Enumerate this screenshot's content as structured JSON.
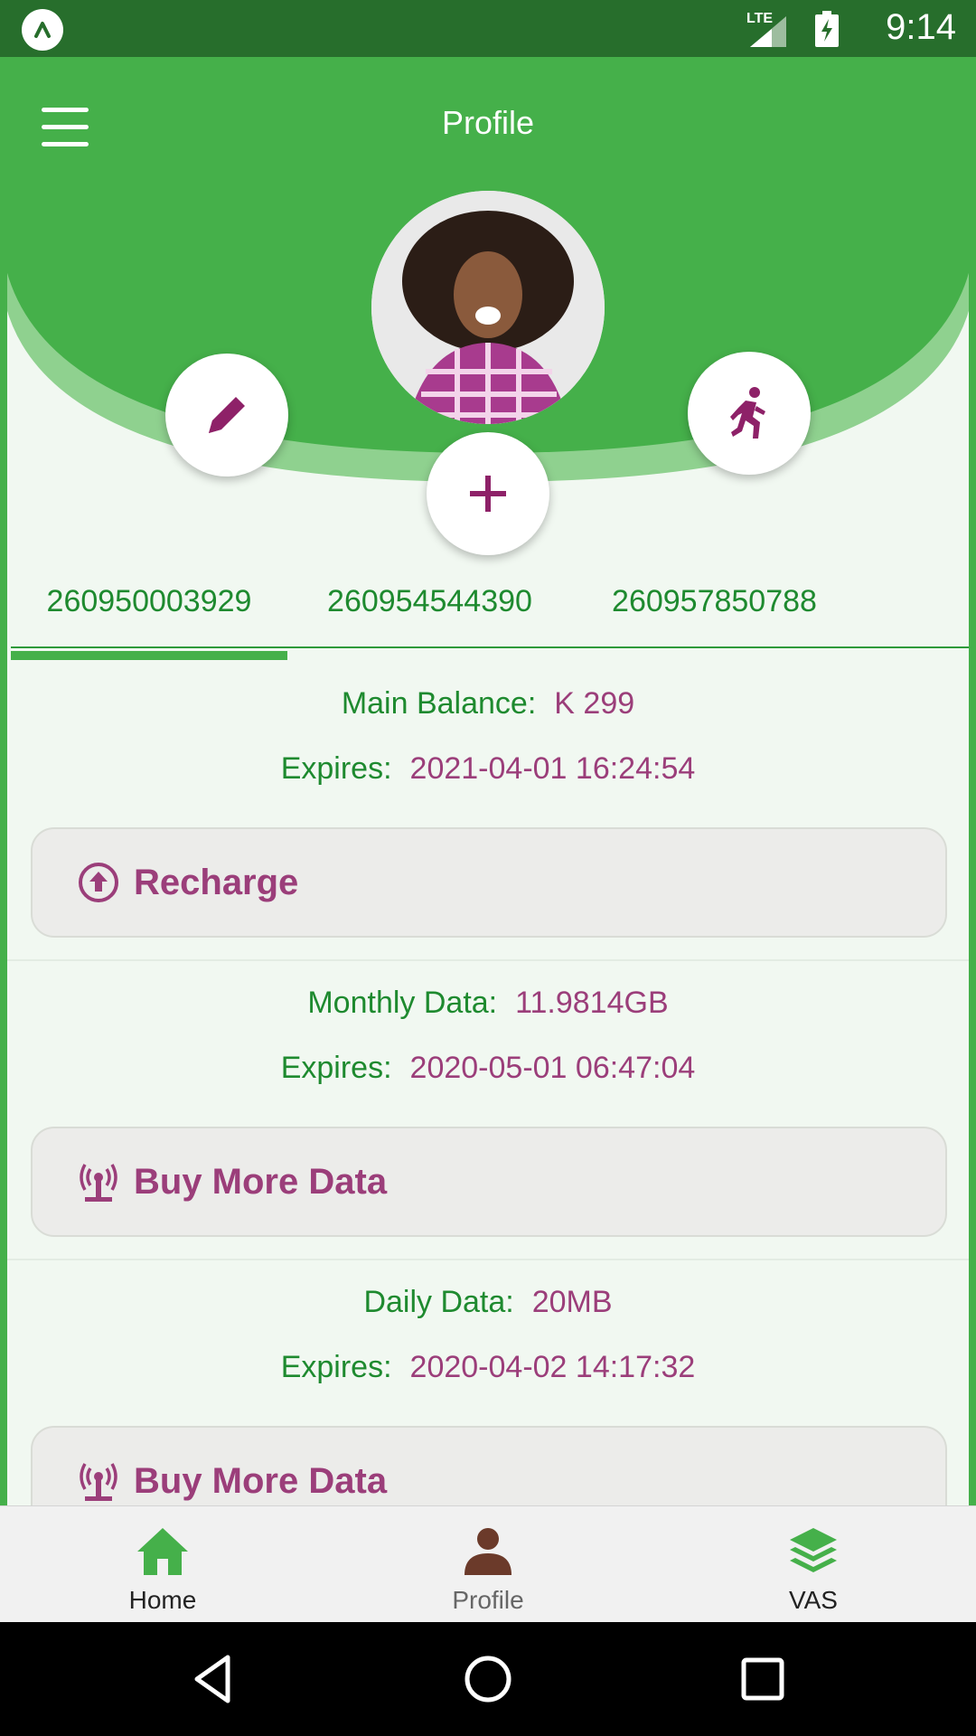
{
  "status_bar": {
    "time": "9:14",
    "network": "LTE",
    "logo_icon": "app-logo-icon"
  },
  "header": {
    "title": "Profile",
    "menu_icon": "hamburger-menu-icon",
    "edit_icon": "pencil-icon",
    "add_icon": "plus-icon",
    "logout_icon": "running-person-icon"
  },
  "tabs": [
    {
      "label": "260950003929",
      "active": true
    },
    {
      "label": "260954544390",
      "active": false
    },
    {
      "label": "260957850788",
      "active": false
    }
  ],
  "balances": [
    {
      "label": "Main Balance:",
      "value": "K 299",
      "expires_label": "Expires:",
      "expires": "2021-04-01 16:24:54",
      "action": "Recharge",
      "action_icon": "upload-circle-icon"
    },
    {
      "label": "Monthly Data:",
      "value": "11.9814GB",
      "expires_label": "Expires:",
      "expires": "2020-05-01 06:47:04",
      "action": "Buy More Data",
      "action_icon": "broadcast-tower-icon"
    },
    {
      "label": "Daily Data:",
      "value": "20MB",
      "expires_label": "Expires:",
      "expires": "2020-04-02 14:17:32",
      "action": "Buy More Data",
      "action_icon": "broadcast-tower-icon"
    }
  ],
  "bottom_nav": [
    {
      "label": "Home",
      "icon": "home-icon",
      "color": "#45b04a"
    },
    {
      "label": "Profile",
      "icon": "person-icon",
      "color": "#6b3a2a"
    },
    {
      "label": "VAS",
      "icon": "layers-icon",
      "color": "#45b04a"
    }
  ],
  "colors": {
    "primary_green": "#45b04a",
    "dark_green": "#276e2c",
    "accent_purple": "#9b3e7a",
    "label_green": "#1e8a2f"
  }
}
